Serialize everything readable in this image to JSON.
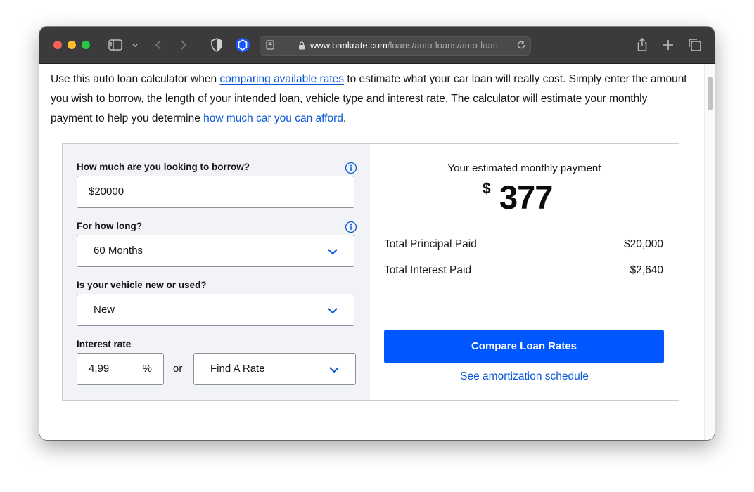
{
  "browser": {
    "url_host": "www.bankrate.com",
    "url_path": "/loans/auto-loans/auto-loan"
  },
  "intro": {
    "text_1": "Use this auto loan calculator when ",
    "link_1": "comparing available rates",
    "text_2": " to estimate what your car loan will really cost. Simply enter the amount you wish to borrow, the length of your intended loan, vehicle type and interest rate. The calculator will estimate your monthly payment to help you determine ",
    "link_2": "how much car you can afford",
    "text_3": "."
  },
  "form": {
    "borrow_label": "How much are you looking to borrow?",
    "borrow_value": "$20000",
    "term_label": "For how long?",
    "term_value": "60 Months",
    "vehicle_label": "Is your vehicle new or used?",
    "vehicle_value": "New",
    "rate_label": "Interest rate",
    "rate_value": "4.99",
    "rate_unit": "%",
    "or_text": "or",
    "find_rate_value": "Find A Rate"
  },
  "results": {
    "heading": "Your estimated monthly payment",
    "currency": "$",
    "monthly_payment": "377",
    "principal_label": "Total Principal Paid",
    "principal_value": "$20,000",
    "interest_label": "Total Interest Paid",
    "interest_value": "$2,640",
    "cta_label": "Compare Loan Rates",
    "schedule_link": "See amortization schedule"
  },
  "colors": {
    "accent": "#0157ff",
    "link": "#0a58d6",
    "form_panel_bg": "#f1f3f6",
    "titlebar_bg": "#3b3b3d"
  }
}
